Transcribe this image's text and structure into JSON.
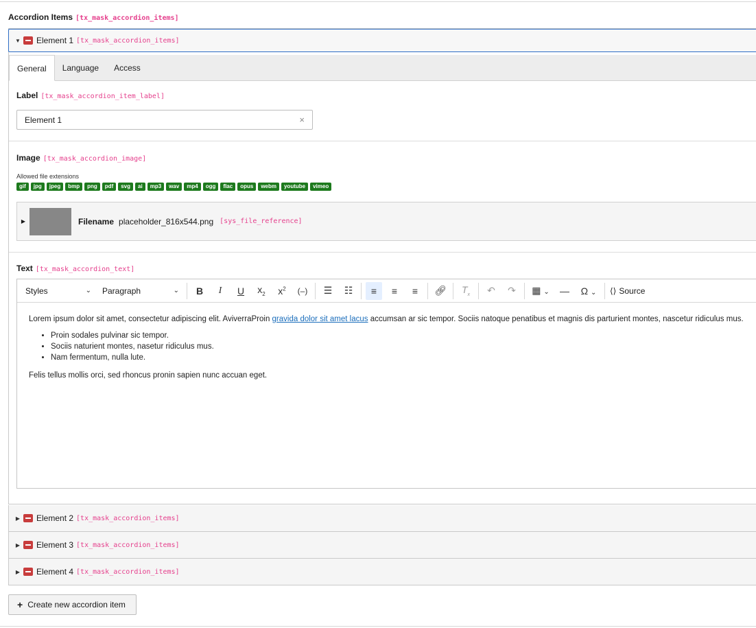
{
  "section": {
    "title": "Accordion Items",
    "key": "[tx_mask_accordion_items]"
  },
  "items": [
    {
      "title": "Element 1",
      "key": "[tx_mask_accordion_items]"
    },
    {
      "title": "Element 2",
      "key": "[tx_mask_accordion_items]"
    },
    {
      "title": "Element 3",
      "key": "[tx_mask_accordion_items]"
    },
    {
      "title": "Element 4",
      "key": "[tx_mask_accordion_items]"
    }
  ],
  "tabs": [
    "General",
    "Language",
    "Access"
  ],
  "label_field": {
    "label": "Label",
    "key": "[tx_mask_accordion_item_label]",
    "value": "Element 1",
    "clear_icon": "×"
  },
  "image_field": {
    "label": "Image",
    "key": "[tx_mask_accordion_image]",
    "allowed_caption": "Allowed file extensions",
    "extensions": [
      "gif",
      "jpg",
      "jpeg",
      "bmp",
      "png",
      "pdf",
      "svg",
      "ai",
      "mp3",
      "wav",
      "mp4",
      "ogg",
      "flac",
      "opus",
      "webm",
      "youtube",
      "vimeo"
    ],
    "file": {
      "filename_label": "Filename",
      "filename": "placeholder_816x544.png",
      "key": "[sys_file_reference]"
    }
  },
  "text_field": {
    "label": "Text",
    "key": "[tx_mask_accordion_text]",
    "toolbar": {
      "styles": "Styles",
      "paragraph": "Paragraph",
      "source": "Source"
    },
    "content": {
      "p1_before": "Lorem ipsum dolor sit amet, consectetur adipiscing elit. AviverraProin ",
      "p1_link": "gravida dolor sit amet lacus",
      "p1_after": " accumsan ar sic tempor. Sociis natoque penatibus et magnis dis parturient montes, nascetur ridiculus mus.",
      "bullets": [
        "Proin sodales pulvinar sic tempor.",
        "Sociis naturient montes, nasetur ridiculus mus.",
        "Nam fermentum, nulla lute."
      ],
      "p2": "Felis tellus mollis orci, sed rhoncus pronin sapien nunc accuan eget."
    }
  },
  "create_button": {
    "label": "Create new accordion item"
  },
  "colors": {
    "accent": "#2c6cc4",
    "badge": "#1d7a1d",
    "key": "#e53f8c",
    "icon": "#c83c3c"
  }
}
